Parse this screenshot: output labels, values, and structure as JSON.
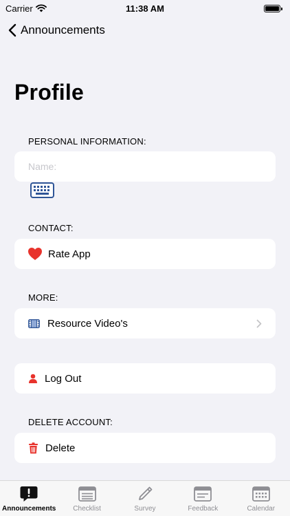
{
  "status_bar": {
    "carrier": "Carrier",
    "time": "11:38 AM"
  },
  "nav": {
    "back_label": "Announcements"
  },
  "page": {
    "title": "Profile"
  },
  "sections": {
    "personal": {
      "header": "PERSONAL INFORMATION:",
      "name_placeholder": "Name:"
    },
    "contact": {
      "header": "CONTACT:",
      "rate_label": "Rate App"
    },
    "more": {
      "header": "MORE:",
      "resource_label": "Resource Video's"
    },
    "logout": {
      "label": "Log Out"
    },
    "delete_account": {
      "header": "DELETE ACCOUNT:",
      "delete_label": "Delete"
    }
  },
  "tabs": [
    {
      "label": "Announcements",
      "icon": "exclamation-bubble-icon",
      "active": true
    },
    {
      "label": "Checklist",
      "icon": "list-icon",
      "active": false
    },
    {
      "label": "Survey",
      "icon": "pencil-icon",
      "active": false
    },
    {
      "label": "Feedback",
      "icon": "feedback-icon",
      "active": false
    },
    {
      "label": "Calendar",
      "icon": "calendar-icon",
      "active": false
    }
  ],
  "colors": {
    "background": "#f2f2f7",
    "card": "#ffffff",
    "heart": "#e8332c",
    "accent_blue": "#2f5597",
    "tab_inactive": "#8e8e93"
  }
}
